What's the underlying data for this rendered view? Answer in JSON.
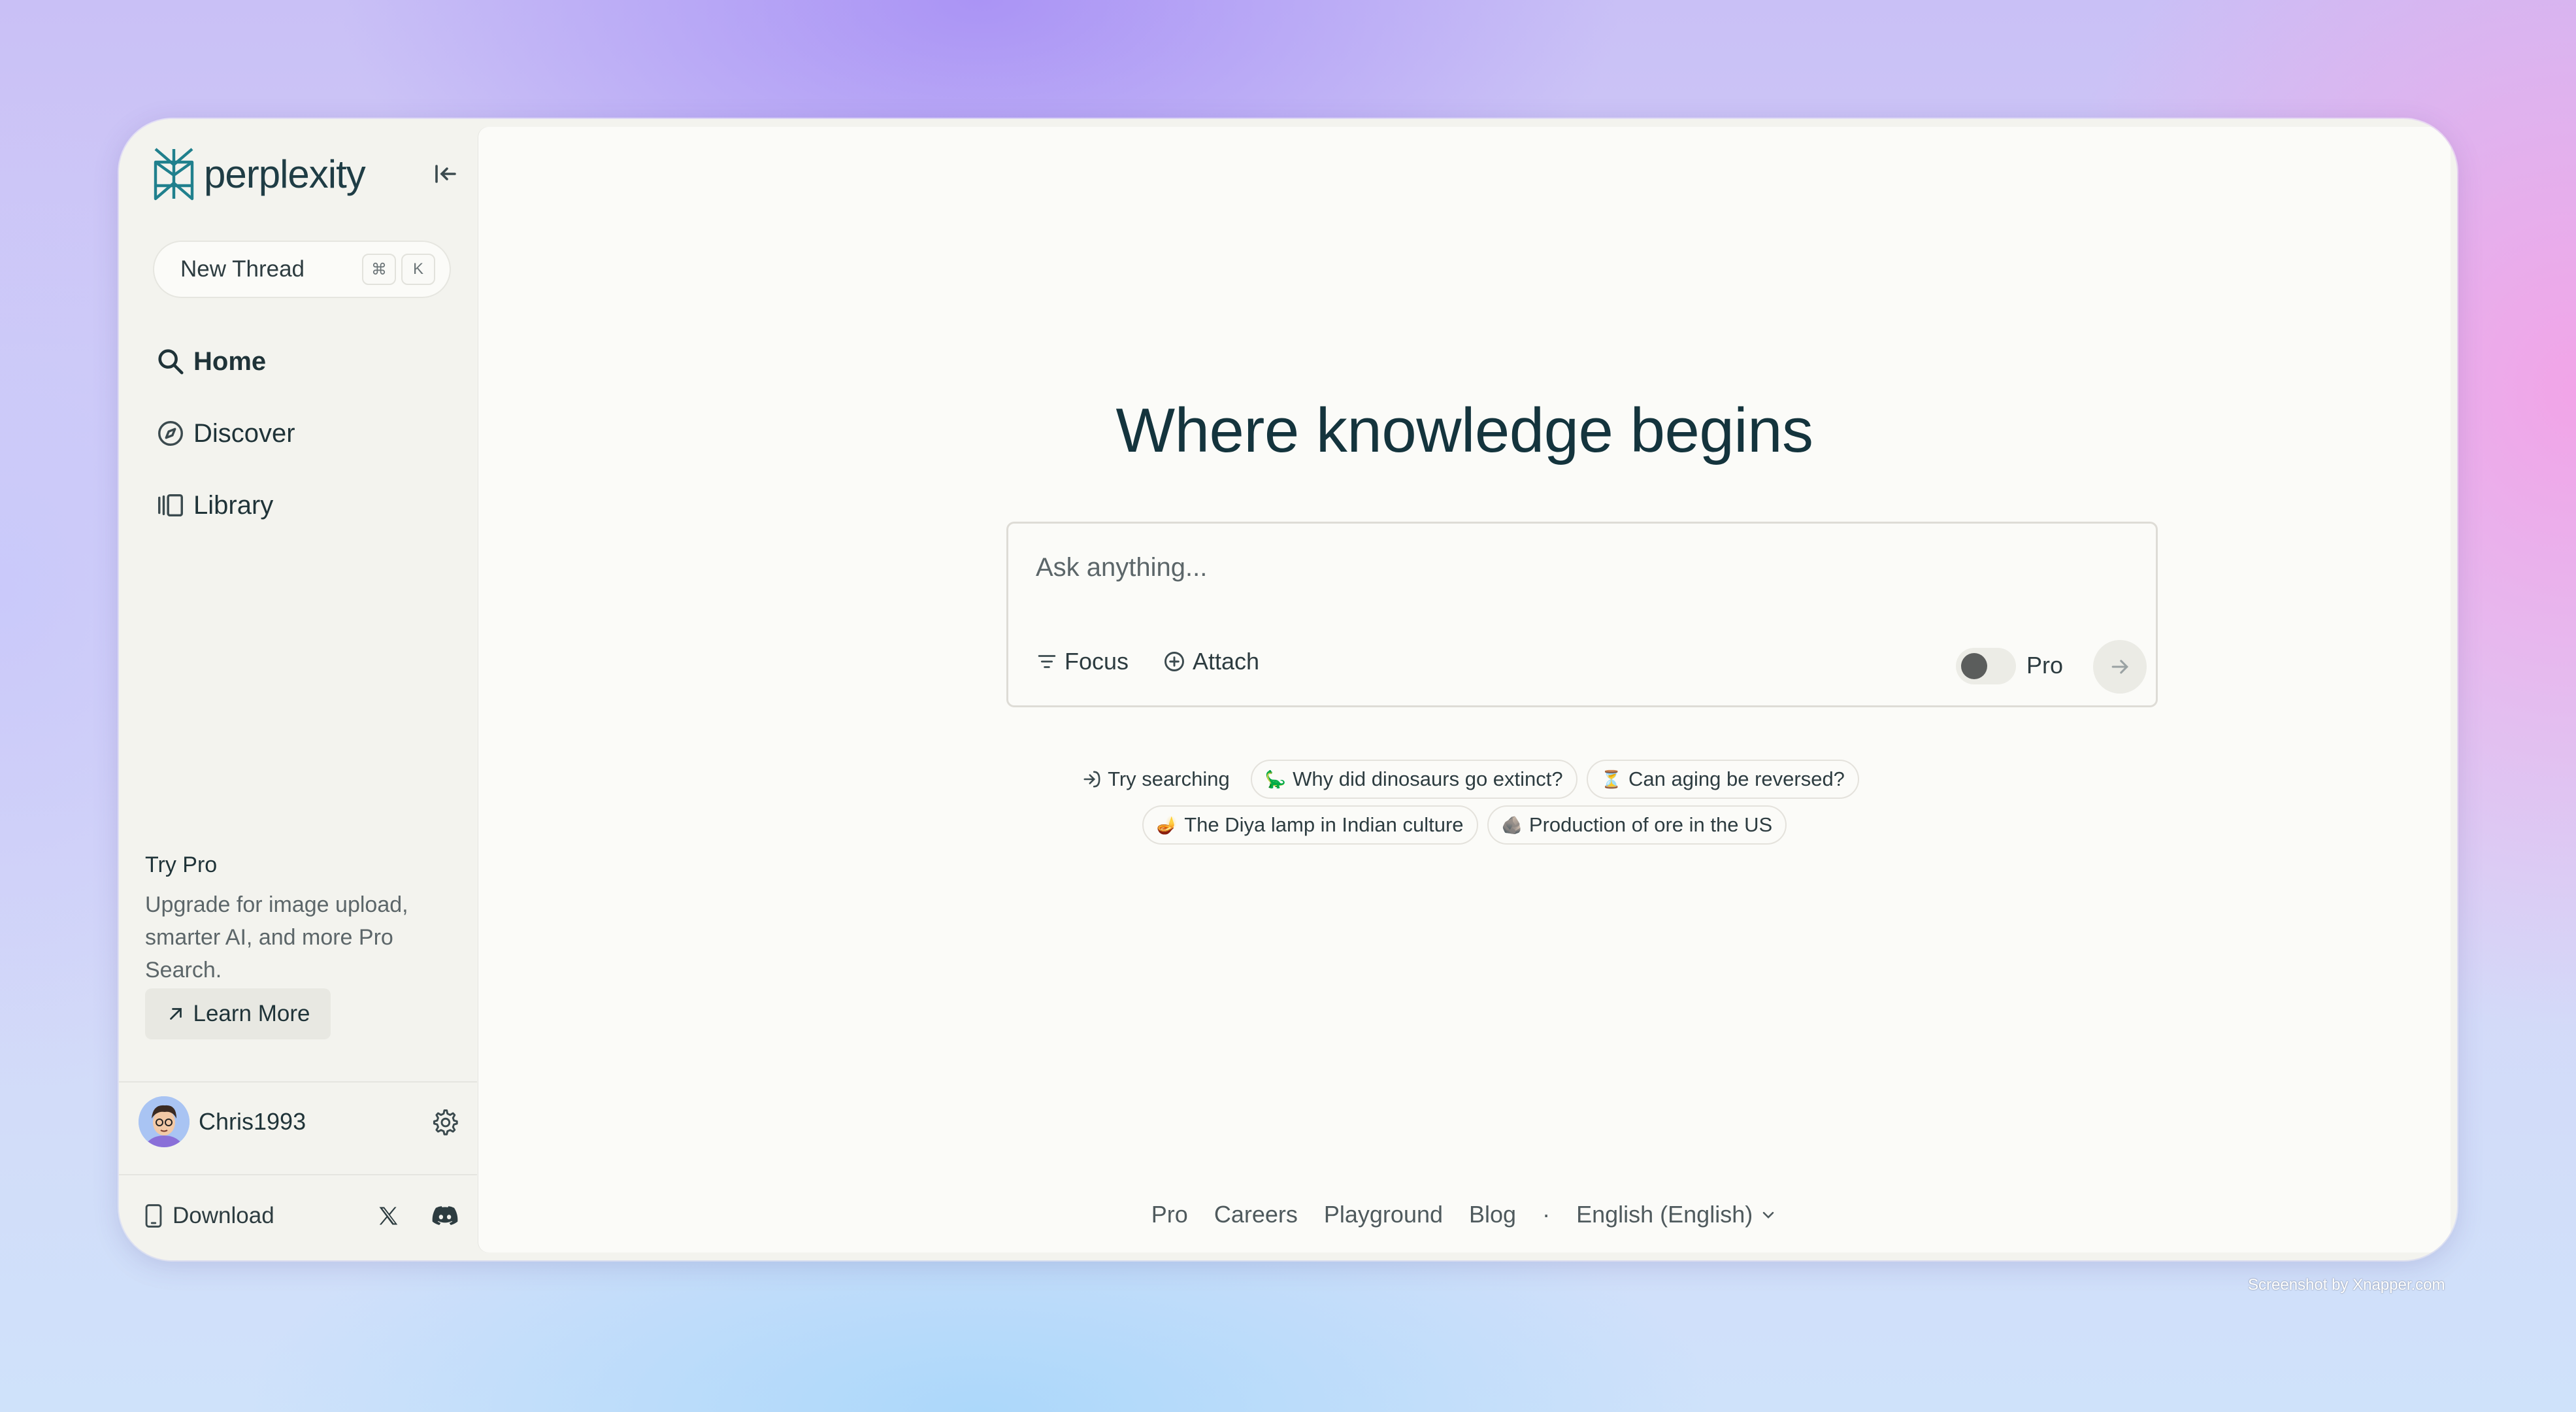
{
  "app": {
    "logo_text": "perplexity",
    "brand_color": "#20808d"
  },
  "sidebar": {
    "new_thread": {
      "label": "New Thread",
      "shortcut_keys": [
        "⌘",
        "K"
      ]
    },
    "nav": [
      {
        "label": "Home",
        "icon": "search-icon"
      },
      {
        "label": "Discover",
        "icon": "compass-icon"
      },
      {
        "label": "Library",
        "icon": "library-icon"
      }
    ],
    "try_pro": {
      "title": "Try Pro",
      "description": "Upgrade for image upload, smarter AI, and more Pro Search.",
      "button_label": "Learn More"
    },
    "user": {
      "name": "Chris1993"
    },
    "footer": {
      "download_label": "Download"
    }
  },
  "main": {
    "title": "Where knowledge begins",
    "search": {
      "placeholder": "Ask anything...",
      "focus_label": "Focus",
      "attach_label": "Attach",
      "pro_label": "Pro",
      "pro_toggle_on": false
    },
    "suggestions": {
      "lead_label": "Try searching",
      "row1": [
        {
          "emoji": "🦕",
          "label": "Why did dinosaurs go extinct?"
        },
        {
          "emoji": "⏳",
          "label": "Can aging be reversed?"
        }
      ],
      "row2": [
        {
          "emoji": "🪔",
          "label": "The Diya lamp in Indian culture"
        },
        {
          "emoji": "🪨",
          "label": "Production of ore in the US"
        }
      ]
    },
    "footer_links": [
      "Pro",
      "Careers",
      "Playground",
      "Blog"
    ],
    "footer_separator": "·",
    "language": "English (English)",
    "help_label": "?"
  },
  "watermark": "Screenshot by Xnapper.com"
}
